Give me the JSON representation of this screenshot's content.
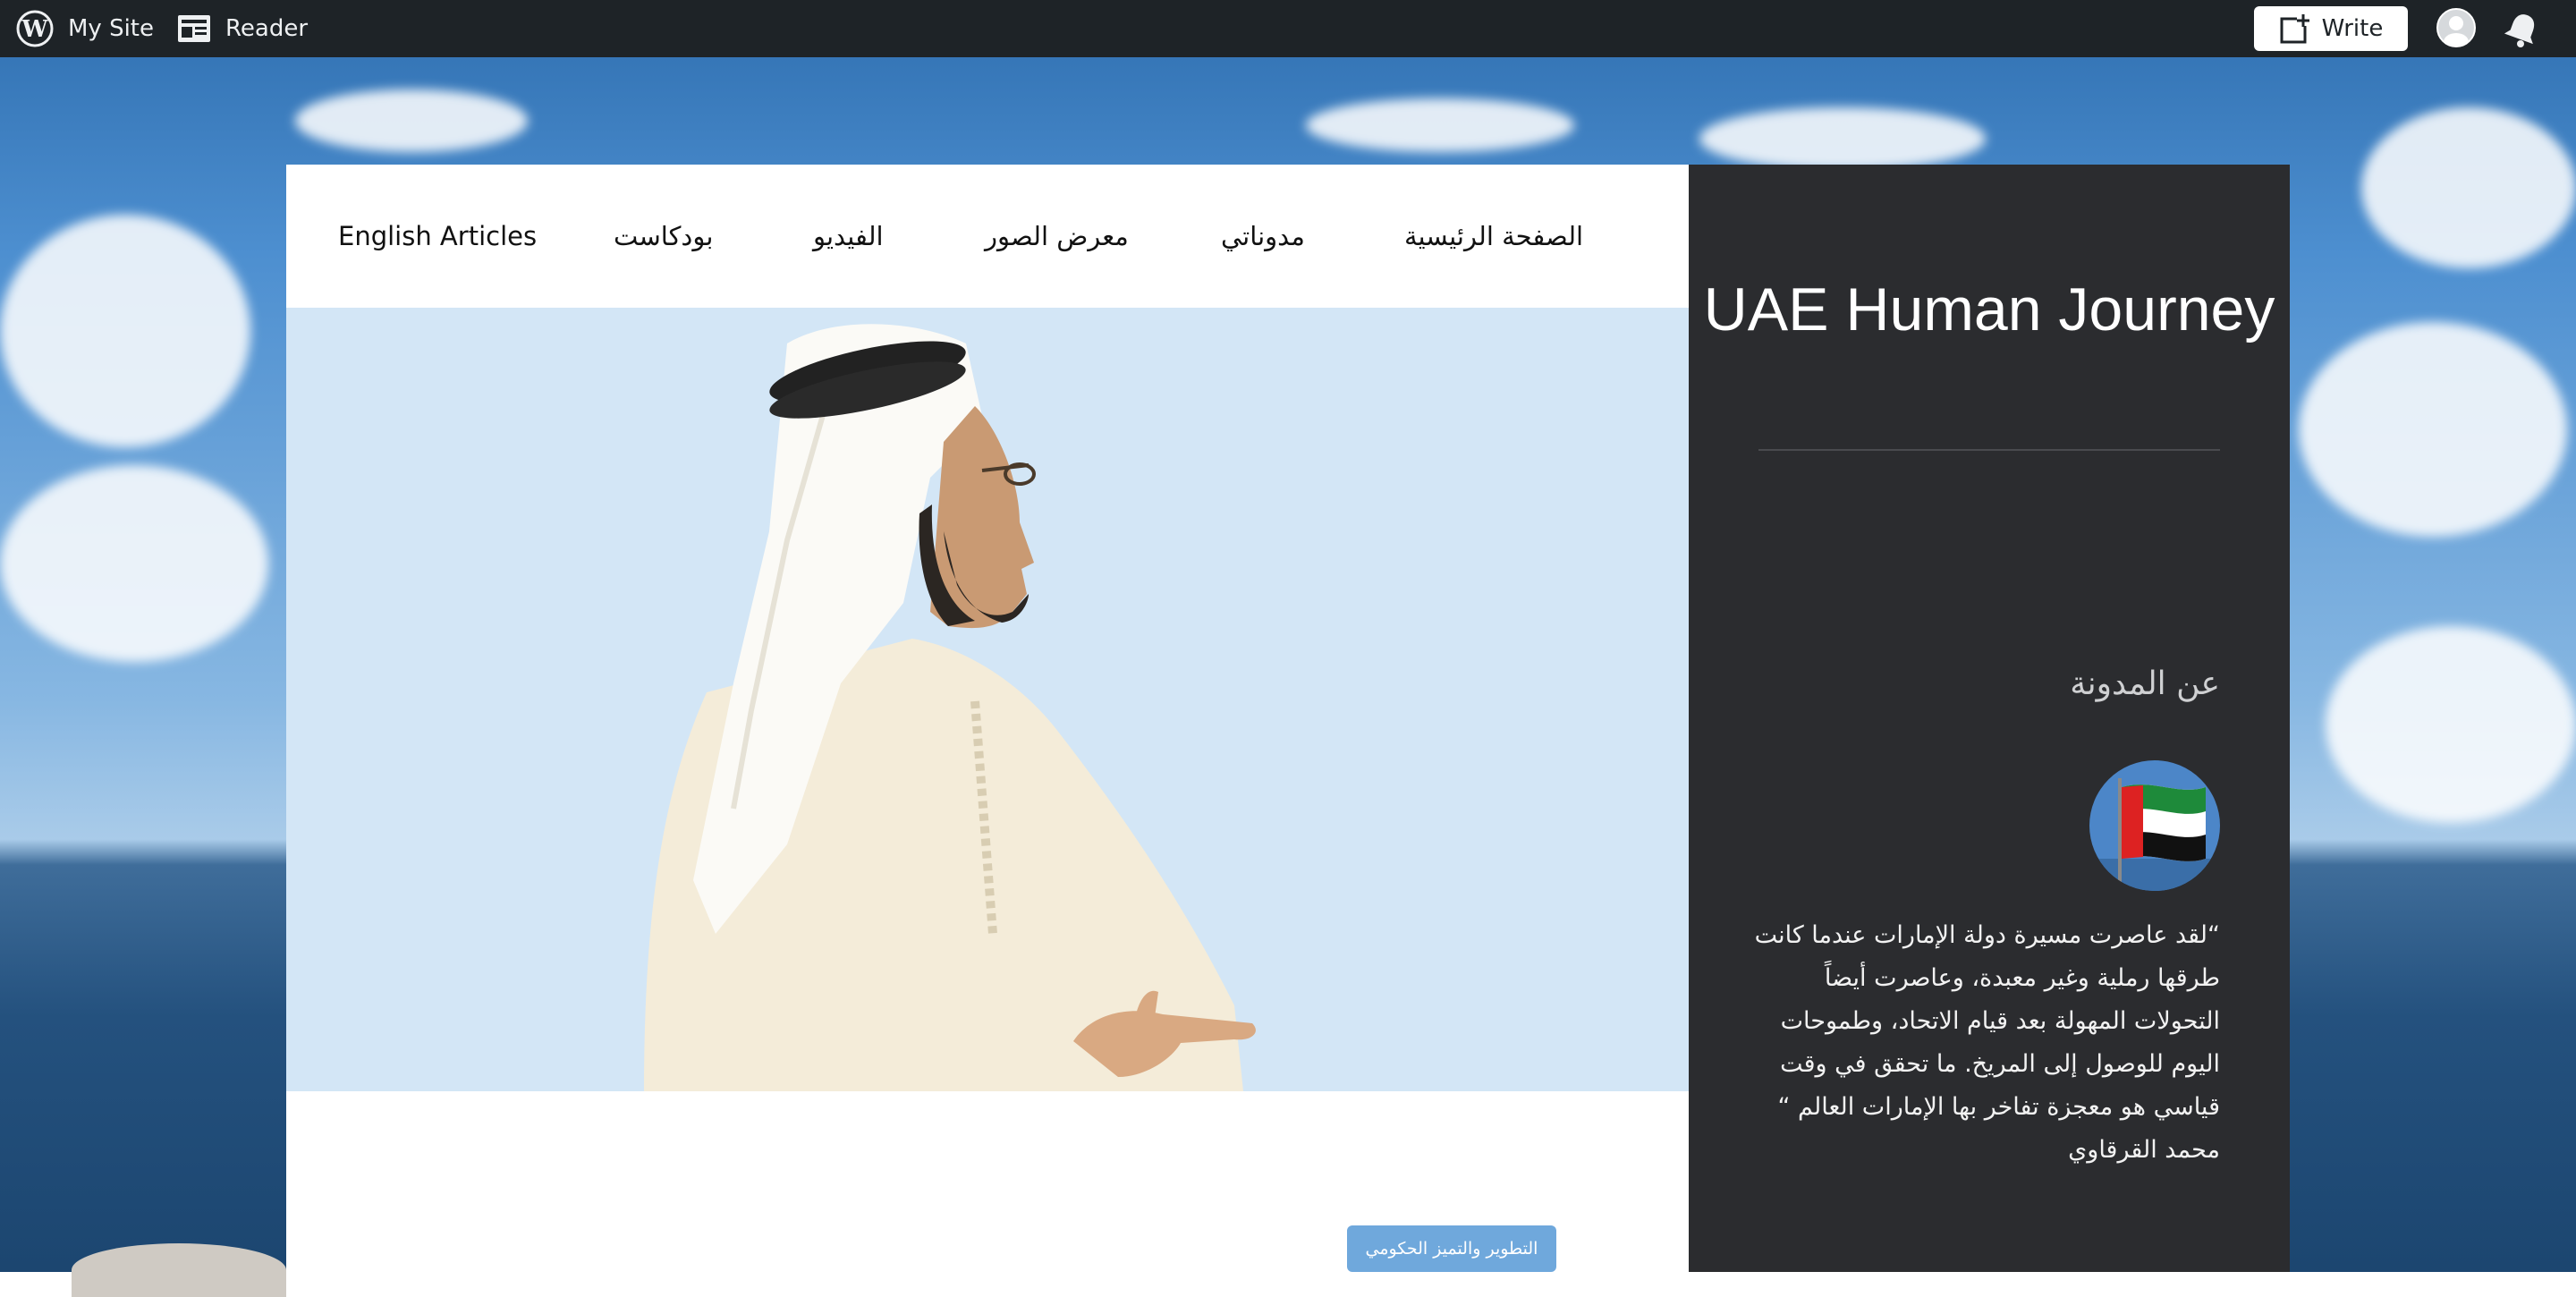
{
  "adminbar": {
    "my_site": "My Site",
    "reader": "Reader",
    "write": "Write"
  },
  "nav": {
    "items": [
      {
        "label": "الصفحة الرئيسية"
      },
      {
        "label": "مدوناتي"
      },
      {
        "label": "معرض الصور"
      },
      {
        "label": "الفيديو"
      },
      {
        "label": "بودكاست"
      },
      {
        "label": "English Articles"
      }
    ]
  },
  "post": {
    "category_button": "التطوير والتميز الحكومي"
  },
  "sidebar": {
    "site_title": "UAE Human Journey",
    "about_heading": "عن المدونة",
    "about_text": "“لقد عاصرت مسيرة دولة الإمارات عندما كانت طرقها رملية وغير معبدة، وعاصرت أيضاً التحولات المهولة بعد قيام الاتحاد، وطموحات اليوم للوصول إلى المريخ. ما تحقق في وقت قياسي هو معجزة تفاخر بها الإمارات العالم “ محمد القرقاوي"
  },
  "colors": {
    "adminbar": "#1e2327",
    "sidebar": "#2b2c2f",
    "hero_bg": "#d3e6f6",
    "button": "#6fa8dc"
  }
}
